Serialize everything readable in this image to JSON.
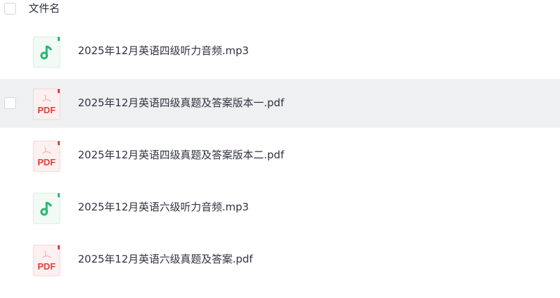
{
  "header": {
    "column_label": "文件名"
  },
  "files": [
    {
      "name": "2025年12月英语四级听力音频.mp3",
      "type": "audio",
      "icon": "music-note-icon"
    },
    {
      "name": "2025年12月英语四级真题及答案版本一.pdf",
      "type": "pdf",
      "icon": "pdf-icon",
      "icon_label": "PDF",
      "hovered": true
    },
    {
      "name": "2025年12月英语四级真题及答案版本二.pdf",
      "type": "pdf",
      "icon": "pdf-icon",
      "icon_label": "PDF"
    },
    {
      "name": "2025年12月英语六级听力音频.mp3",
      "type": "audio",
      "icon": "music-note-icon"
    },
    {
      "name": "2025年12月英语六级真题及答案.pdf",
      "type": "pdf",
      "icon": "pdf-icon",
      "icon_label": "PDF"
    }
  ],
  "colors": {
    "audio_accent": "#2bb673",
    "audio_bg": "#f2faf5",
    "pdf_accent": "#e03e3e",
    "pdf_bg": "#fdf0f0",
    "hover_row": "#eff0f2"
  }
}
